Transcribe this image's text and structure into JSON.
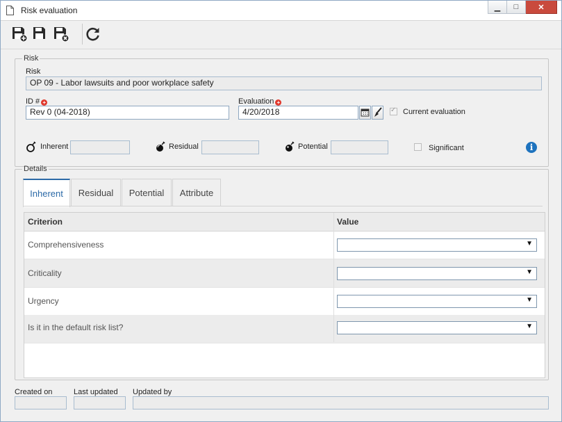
{
  "window": {
    "title": "Risk evaluation",
    "controls": {
      "minimize": "▁",
      "maximize": "□",
      "close": "✕"
    }
  },
  "toolbar": {
    "buttons": [
      {
        "icon": "save-new-icon"
      },
      {
        "icon": "save-icon"
      },
      {
        "icon": "save-close-icon"
      },
      {
        "icon": "refresh-icon"
      }
    ]
  },
  "risk_group": {
    "legend": "Risk",
    "risk_label": "Risk",
    "risk_value": "OP 09 - Labor lawsuits and poor workplace safety",
    "id_label": "ID #",
    "id_value": "Rev 0 (04-2018)",
    "evaluation_label": "Evaluation",
    "evaluation_value": "4/20/2018",
    "current_evaluation_label": "Current evaluation",
    "current_evaluation_checked": true,
    "inherent_label": "Inherent",
    "inherent_value": "",
    "residual_label": "Residual",
    "residual_value": "",
    "potential_label": "Potential",
    "potential_value": "",
    "significant_label": "Significant",
    "significant_checked": false
  },
  "details": {
    "legend": "Details",
    "tabs": [
      {
        "label": "Inherent",
        "active": true
      },
      {
        "label": "Residual",
        "active": false
      },
      {
        "label": "Potential",
        "active": false
      },
      {
        "label": "Attribute",
        "active": false
      }
    ],
    "columns": {
      "criterion": "Criterion",
      "value": "Value"
    },
    "rows": [
      {
        "criterion": "Comprehensiveness",
        "value": ""
      },
      {
        "criterion": "Criticality",
        "value": ""
      },
      {
        "criterion": "Urgency",
        "value": ""
      },
      {
        "criterion": "Is it in the default risk list?",
        "value": ""
      }
    ]
  },
  "footer": {
    "created_on_label": "Created on",
    "created_on_value": "",
    "last_updated_label": "Last updated",
    "last_updated_value": "",
    "updated_by_label": "Updated by",
    "updated_by_value": ""
  },
  "colors": {
    "accent": "#2c6aa7",
    "required": "#e0372b",
    "info": "#1e73be"
  }
}
